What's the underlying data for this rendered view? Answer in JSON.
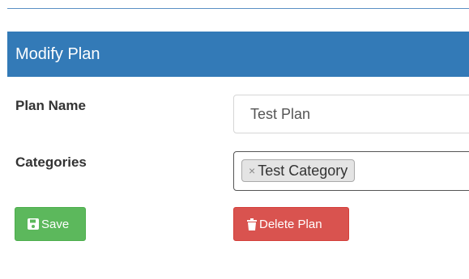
{
  "panel": {
    "title": "Modify Plan"
  },
  "form": {
    "plan_name_label": "Plan Name",
    "plan_name_value": "Test Plan",
    "categories_label": "Categories",
    "categories": [
      {
        "remove_glyph": "×",
        "label": "Test Category"
      }
    ]
  },
  "actions": {
    "save_label": "Save",
    "save_icon": "floppy-disk-icon",
    "delete_label": "Delete Plan",
    "delete_icon": "trash-icon"
  },
  "colors": {
    "header_bg": "#337ab7",
    "save_bg": "#5cb85c",
    "delete_bg": "#d9534f",
    "tag_bg": "#e4e4e4"
  }
}
